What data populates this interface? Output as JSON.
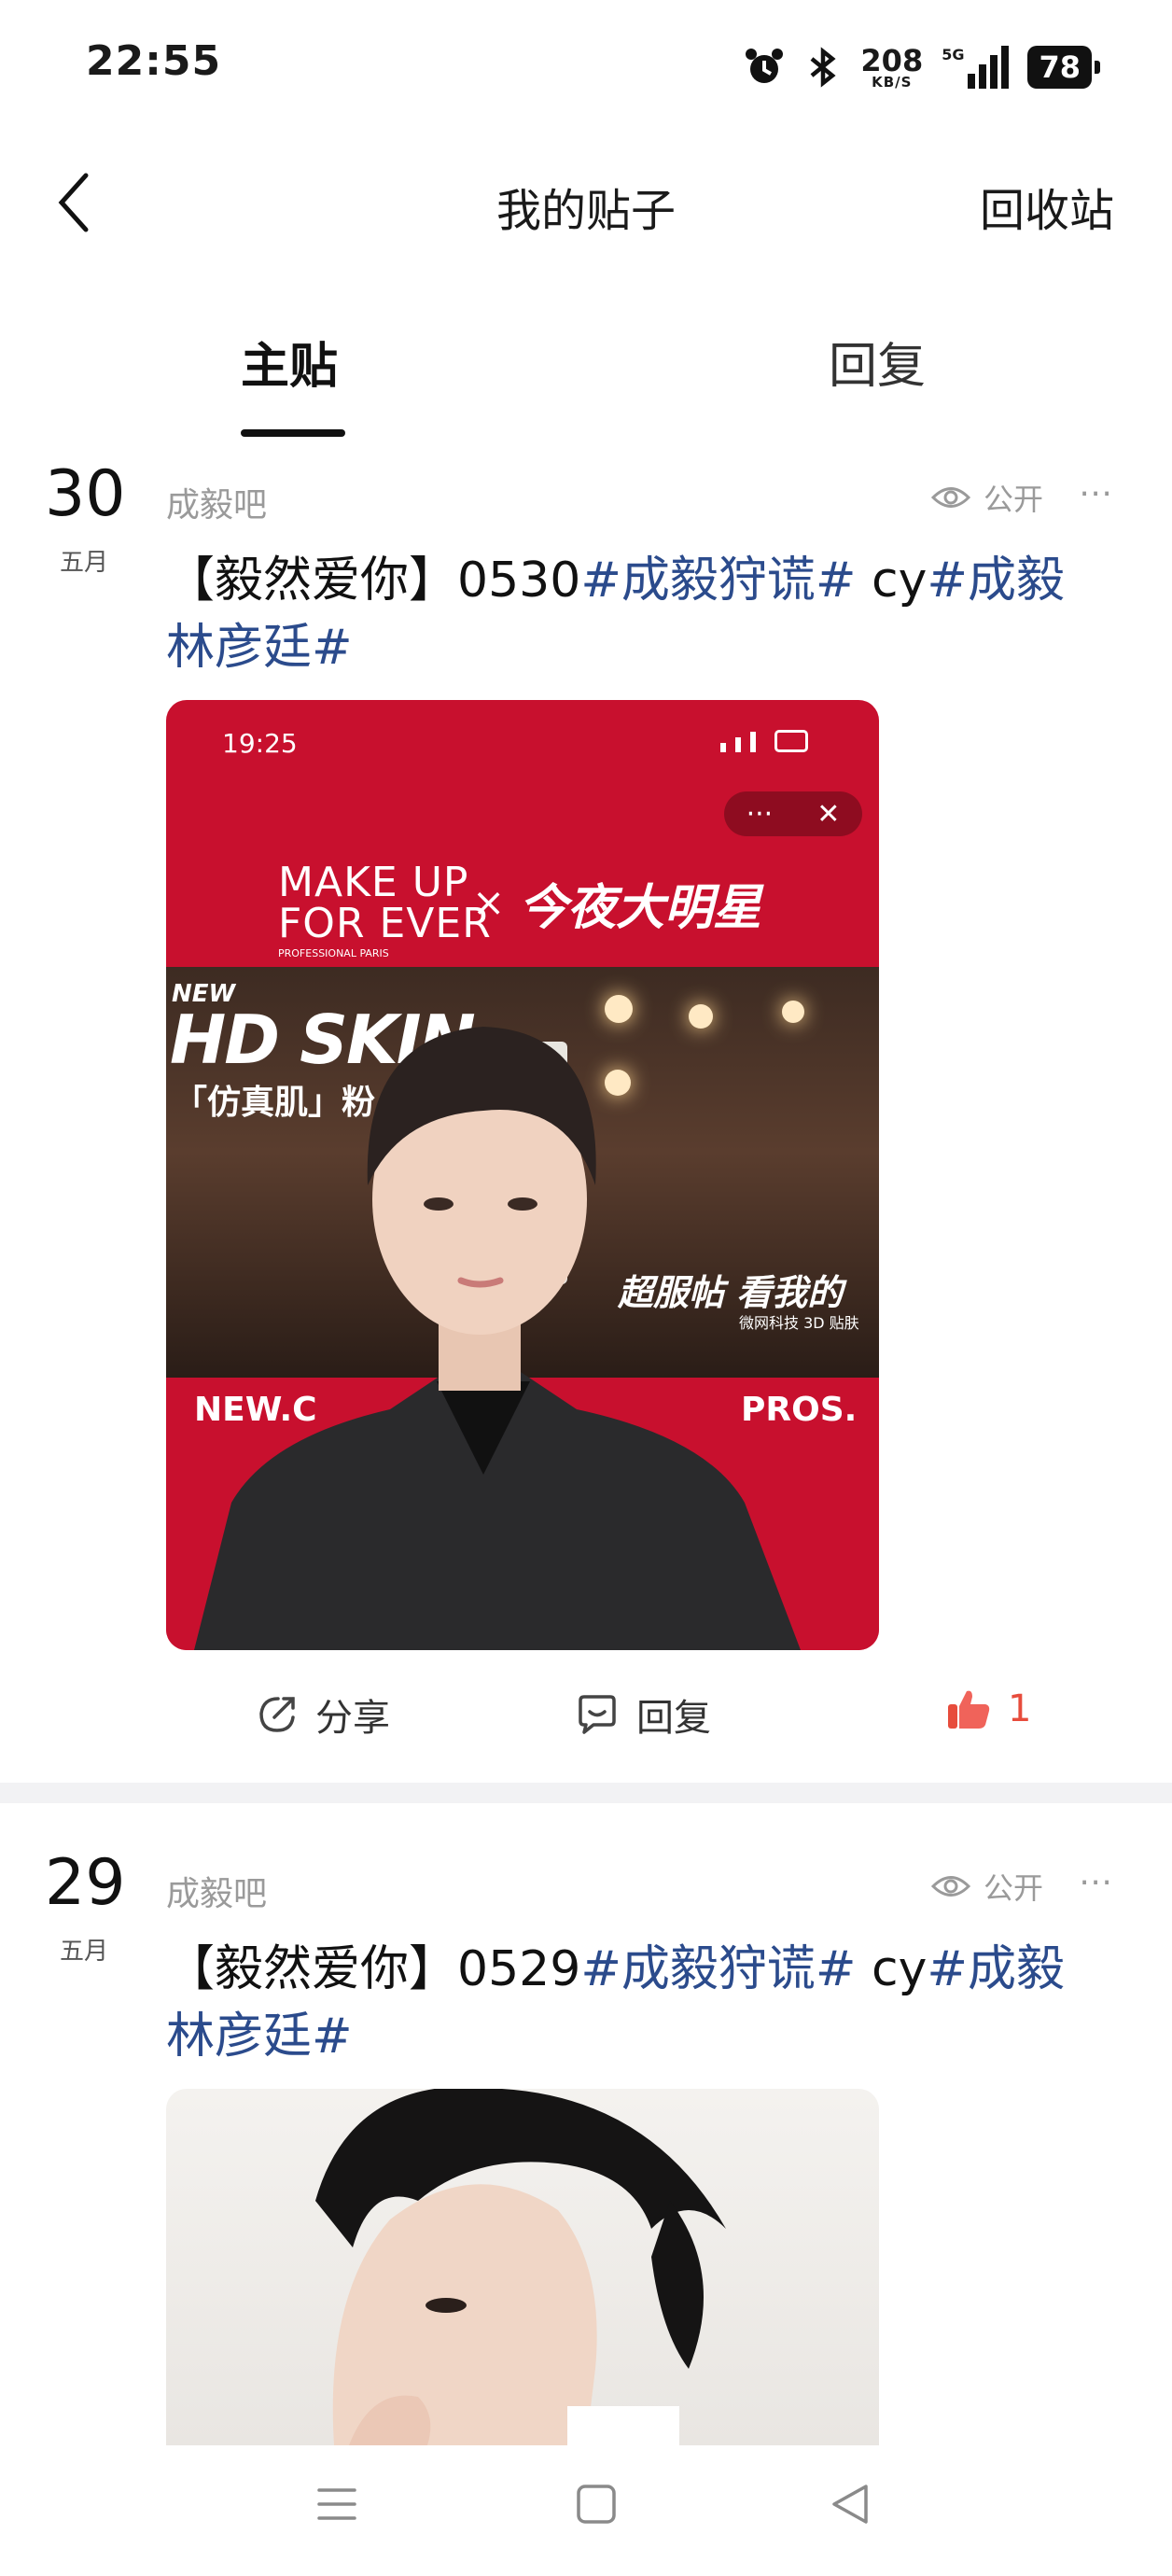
{
  "status": {
    "time": "22:55",
    "net_speed": "208",
    "net_unit": "KB/S",
    "signal_label": "5G",
    "battery": "78"
  },
  "header": {
    "title": "我的贴子",
    "right_action": "回收站"
  },
  "tabs": [
    {
      "label": "主贴",
      "active": true
    },
    {
      "label": "回复",
      "active": false
    }
  ],
  "posts": [
    {
      "day": "30",
      "month": "五月",
      "forum": "成毅吧",
      "visibility": "公开",
      "title_prefix": "【毅然爱你】0530",
      "tag1": "#成毅狩谎#",
      "mid": " cy",
      "tag2": "#成毅林彦廷#",
      "image": {
        "phone_time": "19:25",
        "brand_top": "MAKE UP",
        "brand_bottom": "FOR EVER",
        "brand_sub": "PROFESSIONAL PARIS",
        "cross": "×",
        "show_name": "今夜大明星",
        "banner_new": "NEW",
        "banner_main": "HD SKIN",
        "banner_cn": "「仿真肌」粉",
        "slogan": "超服帖 看我的",
        "slogan_sub": "微网科技 3D 贴肤",
        "bottom_left": "NEW.C",
        "bottom_right": "PROS."
      },
      "actions": {
        "share": "分享",
        "reply": "回复",
        "likes": "1"
      }
    },
    {
      "day": "29",
      "month": "五月",
      "forum": "成毅吧",
      "visibility": "公开",
      "title_prefix": "【毅然爱你】0529",
      "tag1": "#成毅狩谎#",
      "mid": " cy",
      "tag2": "#成毅林彦廷#"
    }
  ],
  "colors": {
    "tag": "#2b4b8c",
    "brand_red": "#c8102e",
    "like": "#e74c3c"
  }
}
